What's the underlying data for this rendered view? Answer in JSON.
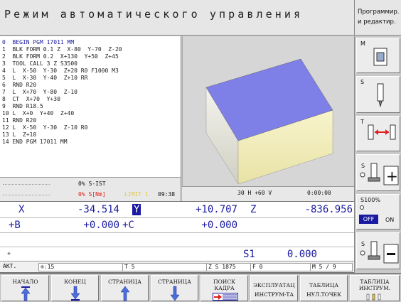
{
  "header": {
    "title": "Режим автоматического управления",
    "mode2_line1": "Программир.",
    "mode2_line2": "и редактир."
  },
  "program": {
    "lines": [
      "0  BEGIN PGM 17011 MM",
      "1  BLK FORM 0.1 Z  X-80  Y-70  Z-20",
      "2  BLK FORM 0.2  X+130  Y+50  Z+45",
      "3  TOOL CALL 3 Z S3500",
      "4  L  X-50  Y-30  Z+20 R0 F1000 M3",
      "5  L  X-30  Y-40  Z+10 RR",
      "6  RND R20",
      "7  L  X+70  Y-80  Z-10",
      "8  CT  X+70  Y+30",
      "9  RND R18.5",
      "10 L  X+0  Y+40  Z+40",
      "11 RND R20",
      "12 L  X-50  Y-30  Z-10 R0",
      "13 L  Z+10",
      "14 END PGM 17011 MM"
    ]
  },
  "status": {
    "s_ist": "0% S-IST",
    "s_nm": "0% S[Nm]",
    "limit": "LIMIT 1",
    "time": "09:38"
  },
  "graphic": {
    "view": "30 H +60 V",
    "runtime": "0:00:00"
  },
  "coords": {
    "x_label": "X",
    "x_value": "-34.514",
    "y_label": "Y",
    "y_value": "+10.707",
    "z_label": "Z",
    "z_value": "-836.956",
    "b_label": "+B",
    "b_value": "+0.000",
    "c_label": "+C",
    "c_value": "+0.000",
    "s1_label": "S1",
    "s1_value": "0.000"
  },
  "statusrow": {
    "mode": "АКТ.",
    "feed_pct": "15",
    "tool": "T 5",
    "axis_speed": "Z S 1875",
    "f": "F 0",
    "m": "M 5 / 9"
  },
  "sidekeys": {
    "m": "M",
    "s": "S",
    "t": "T",
    "pct": "S100%",
    "off": "OFF",
    "on": "ON"
  },
  "bottomkeys": [
    {
      "line1": "НАЧАЛО",
      "line2": ""
    },
    {
      "line1": "КОНЕЦ",
      "line2": ""
    },
    {
      "line1": "СТРАНИЦА",
      "line2": ""
    },
    {
      "line1": "СТРАНИЦА",
      "line2": ""
    },
    {
      "line1": "ПОИСК",
      "line2": "КАДРА"
    },
    {
      "line1": "ЭКСПЛУАТАЦ",
      "line2": "ИНСТРУМ-ТА"
    },
    {
      "line1": "ТАБЛИЦА",
      "line2": "НУЛ.ТОЧЕК"
    },
    {
      "line1": "ТАБЛИЦА",
      "line2": "ИНСТРУМ."
    }
  ],
  "colors": {
    "accent": "#1a1aa0",
    "warning": "#e0201a",
    "block_top": "#7f7fe8"
  }
}
